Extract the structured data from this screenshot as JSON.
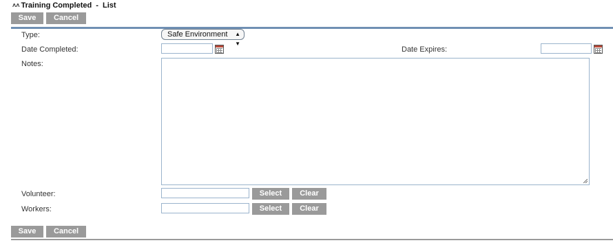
{
  "header": {
    "collapse_icon": "double-chevron-up-icon",
    "title": "Training Completed",
    "separator": "-",
    "list_link": "List"
  },
  "toolbar_top": {
    "save_label": "Save",
    "cancel_label": "Cancel"
  },
  "form": {
    "type_label": "Type:",
    "type_value": "Safe Environment",
    "date_completed_label": "Date Completed:",
    "date_completed_value": "",
    "date_expires_label": "Date Expires:",
    "date_expires_value": "",
    "notes_label": "Notes:",
    "notes_value": "",
    "volunteer_label": "Volunteer:",
    "volunteer_value": "",
    "workers_label": "Workers:",
    "workers_value": "",
    "select_label": "Select",
    "clear_label": "Clear"
  },
  "toolbar_bottom": {
    "save_label": "Save",
    "cancel_label": "Cancel"
  },
  "colors": {
    "button_bg": "#9a9a9a",
    "rule_accent": "#6f8fb3",
    "field_border": "#9ab3cc"
  }
}
